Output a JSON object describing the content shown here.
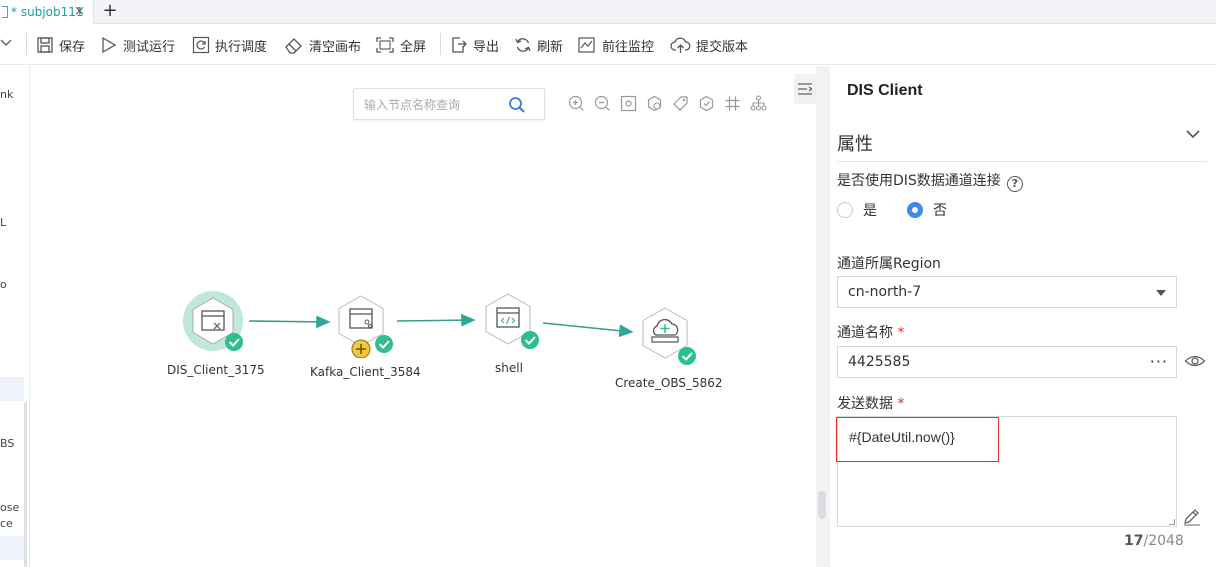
{
  "tabs": [
    {
      "label": "* subjob111",
      "close": "×"
    }
  ],
  "tab_add": "+",
  "toolbar": {
    "items": [
      {
        "label": "保存",
        "icon": "save-icon"
      },
      {
        "label": "测试运行",
        "icon": "play-icon"
      },
      {
        "label": "执行调度",
        "icon": "schedule-icon"
      },
      {
        "label": "清空画布",
        "icon": "eraser-icon"
      },
      {
        "label": "全屏",
        "icon": "fullscreen-icon"
      },
      {
        "label": "导出",
        "icon": "export-icon"
      },
      {
        "label": "刷新",
        "icon": "refresh-icon"
      },
      {
        "label": "前往监控",
        "icon": "monitor-icon"
      },
      {
        "label": "提交版本",
        "icon": "upload-cloud-icon"
      }
    ]
  },
  "left_panel": {
    "fragments": [
      "nk",
      "L",
      "o",
      "BS",
      "ose",
      "ce"
    ]
  },
  "canvas": {
    "search_placeholder": "输入节点名称查询",
    "zoom_tools": [
      "zoom-in-icon",
      "zoom-out-icon",
      "fit-icon",
      "node-icon-a",
      "tag-icon",
      "node-icon-b",
      "grid-icon",
      "tree-icon"
    ],
    "nodes": [
      {
        "label": "DIS_Client_3175",
        "status": "success",
        "selected": true
      },
      {
        "label": "Kafka_Client_3584",
        "status": "success",
        "warning": true
      },
      {
        "label": "shell",
        "status": "success"
      },
      {
        "label": "Create_OBS_5862",
        "status": "success"
      }
    ]
  },
  "properties": {
    "title": "DIS Client",
    "section": "属性",
    "use_dis_label": "是否使用DIS数据通道连接",
    "help": "?",
    "options": [
      {
        "label": "是",
        "selected": false
      },
      {
        "label": "否",
        "selected": true
      }
    ],
    "region_label": "通道所属Region",
    "region_value": "cn-north-7",
    "channel_label": "通道名称",
    "channel_value": "4425585",
    "channel_more": "···",
    "send_label": "发送数据",
    "required_mark": "*",
    "send_value": "#{DateUtil.now()}",
    "char_count": "17",
    "char_limit": "/2048"
  },
  "colors": {
    "accent": "#1aa0a0",
    "success": "#2fbf8f",
    "radio": "#3d8ae8",
    "highlight": "#e0352b"
  }
}
